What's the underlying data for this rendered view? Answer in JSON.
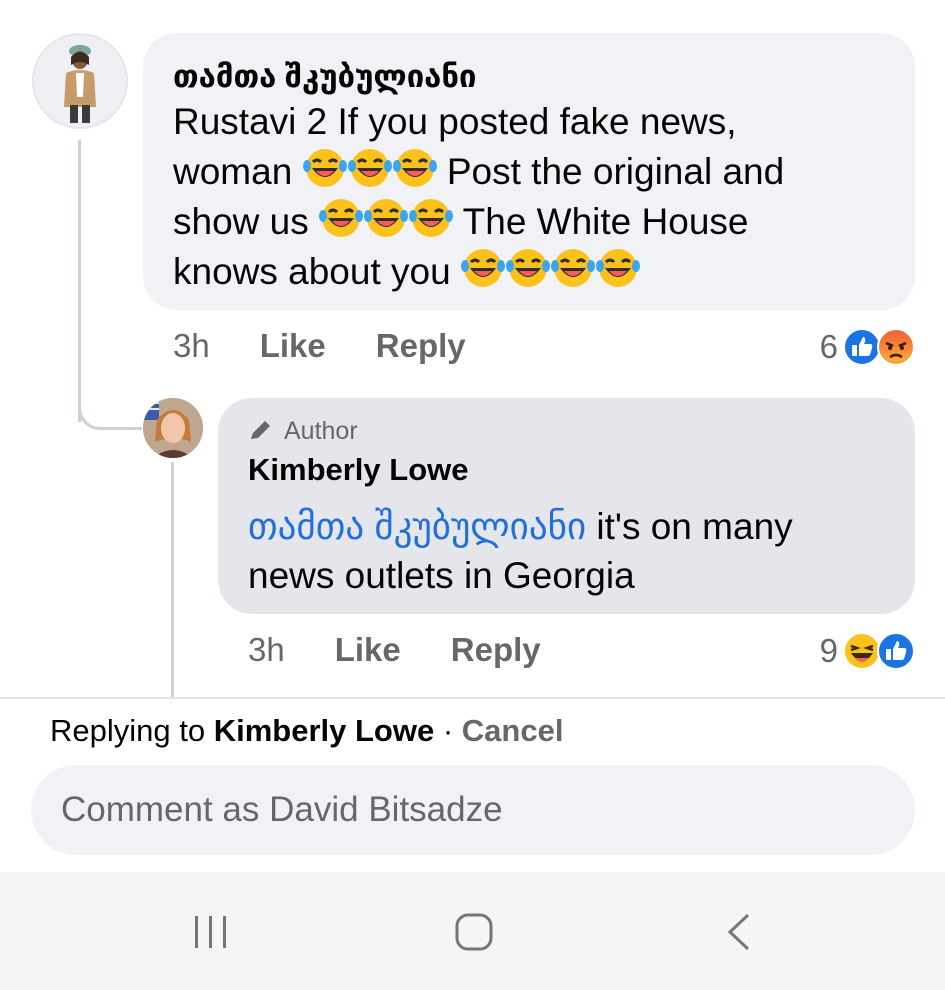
{
  "comment": {
    "author": "თამთა შკუბულიანი",
    "text_segments": [
      "Rustavi 2 If you posted fake news,",
      "woman",
      "Post the original and",
      "show us",
      "The White House",
      "knows about you"
    ],
    "time": "3h",
    "like_label": "Like",
    "reply_label": "Reply",
    "reaction_count": "6",
    "reactions": [
      "like-icon",
      "angry-icon"
    ]
  },
  "reply": {
    "badge": "Author",
    "author": "Kimberly Lowe",
    "mention": "თამთა შკუბულიანი",
    "text_line1": " it's on many",
    "text_line2": "news outlets in Georgia",
    "time": "3h",
    "like_label": "Like",
    "reply_label": "Reply",
    "reaction_count": "9",
    "reactions": [
      "haha-icon",
      "like-icon"
    ]
  },
  "replying_bar": {
    "prefix": "Replying to ",
    "name": "Kimberly Lowe",
    "separator": " · ",
    "cancel": "Cancel"
  },
  "composer": {
    "placeholder": "Comment as David Bitsadze"
  },
  "colors": {
    "accent_blue": "#216fdb",
    "bubble_bg": "#f0f2f5",
    "author_bubble_bg": "#e4e6eb",
    "secondary_text": "#65676b"
  }
}
